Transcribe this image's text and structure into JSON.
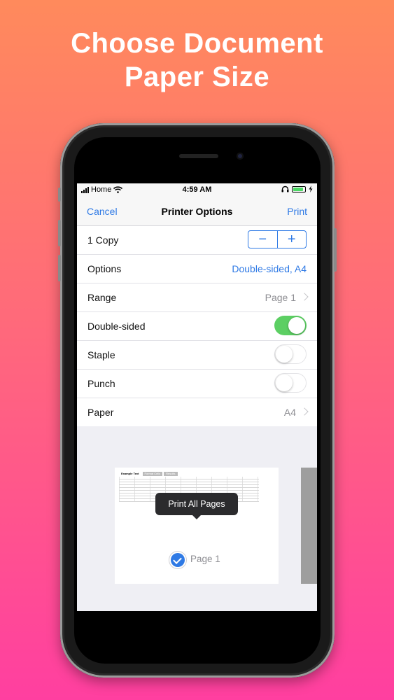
{
  "headline": {
    "line1": "Choose Document",
    "line2": "Paper Size"
  },
  "status_bar": {
    "carrier": "Home",
    "time": "4:59 AM"
  },
  "nav": {
    "cancel": "Cancel",
    "title": "Printer Options",
    "print": "Print"
  },
  "options": [
    {
      "label": "1 Copy",
      "type": "stepper",
      "minus": "−",
      "plus": "+"
    },
    {
      "label": "Options",
      "type": "value",
      "value": "Double-sided, A4"
    },
    {
      "label": "Range",
      "type": "disclosure",
      "value": "Page 1"
    },
    {
      "label": "Double-sided",
      "type": "toggle",
      "on": true
    },
    {
      "label": "Staple",
      "type": "toggle",
      "on": false
    },
    {
      "label": "Punch",
      "type": "toggle",
      "on": false
    },
    {
      "label": "Paper",
      "type": "disclosure",
      "value": "A4"
    }
  ],
  "preview": {
    "sheet_tabs": [
      "Example Text",
      "Format Cells",
      "Results"
    ],
    "tooltip": "Print All Pages",
    "page_label": "Page 1"
  },
  "colors": {
    "accent": "#2f7ae5",
    "toggle_on": "#5ccf63",
    "bg_top": "#ff8a5c",
    "bg_bottom": "#ff3fa0"
  }
}
